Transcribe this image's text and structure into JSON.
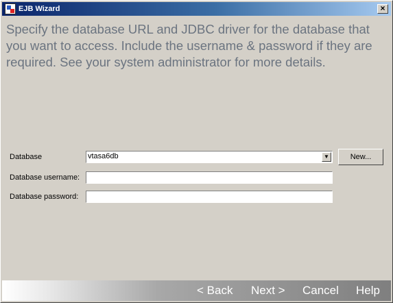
{
  "window": {
    "title": "EJB Wizard",
    "close_glyph": "×"
  },
  "instructions": "Specify the database URL and JDBC driver for the database that you want to access.  Include the username & password if they are required.  See your system administrator for more details.",
  "form": {
    "database_label": "Database",
    "database_value": "vtasa6db",
    "new_button": "New...",
    "username_label": "Database username:",
    "username_value": "",
    "password_label": "Database password:",
    "password_value": ""
  },
  "footer": {
    "back": "< Back",
    "next": "Next >",
    "cancel": "Cancel",
    "help": "Help"
  },
  "icons": {
    "app": "ejb-wizard-icon",
    "dropdown": "dropdown-arrow-icon"
  },
  "colors": {
    "title_bar": "#0a246a",
    "window_bg": "#d4d0c8",
    "instructions_text": "#6b7480"
  }
}
